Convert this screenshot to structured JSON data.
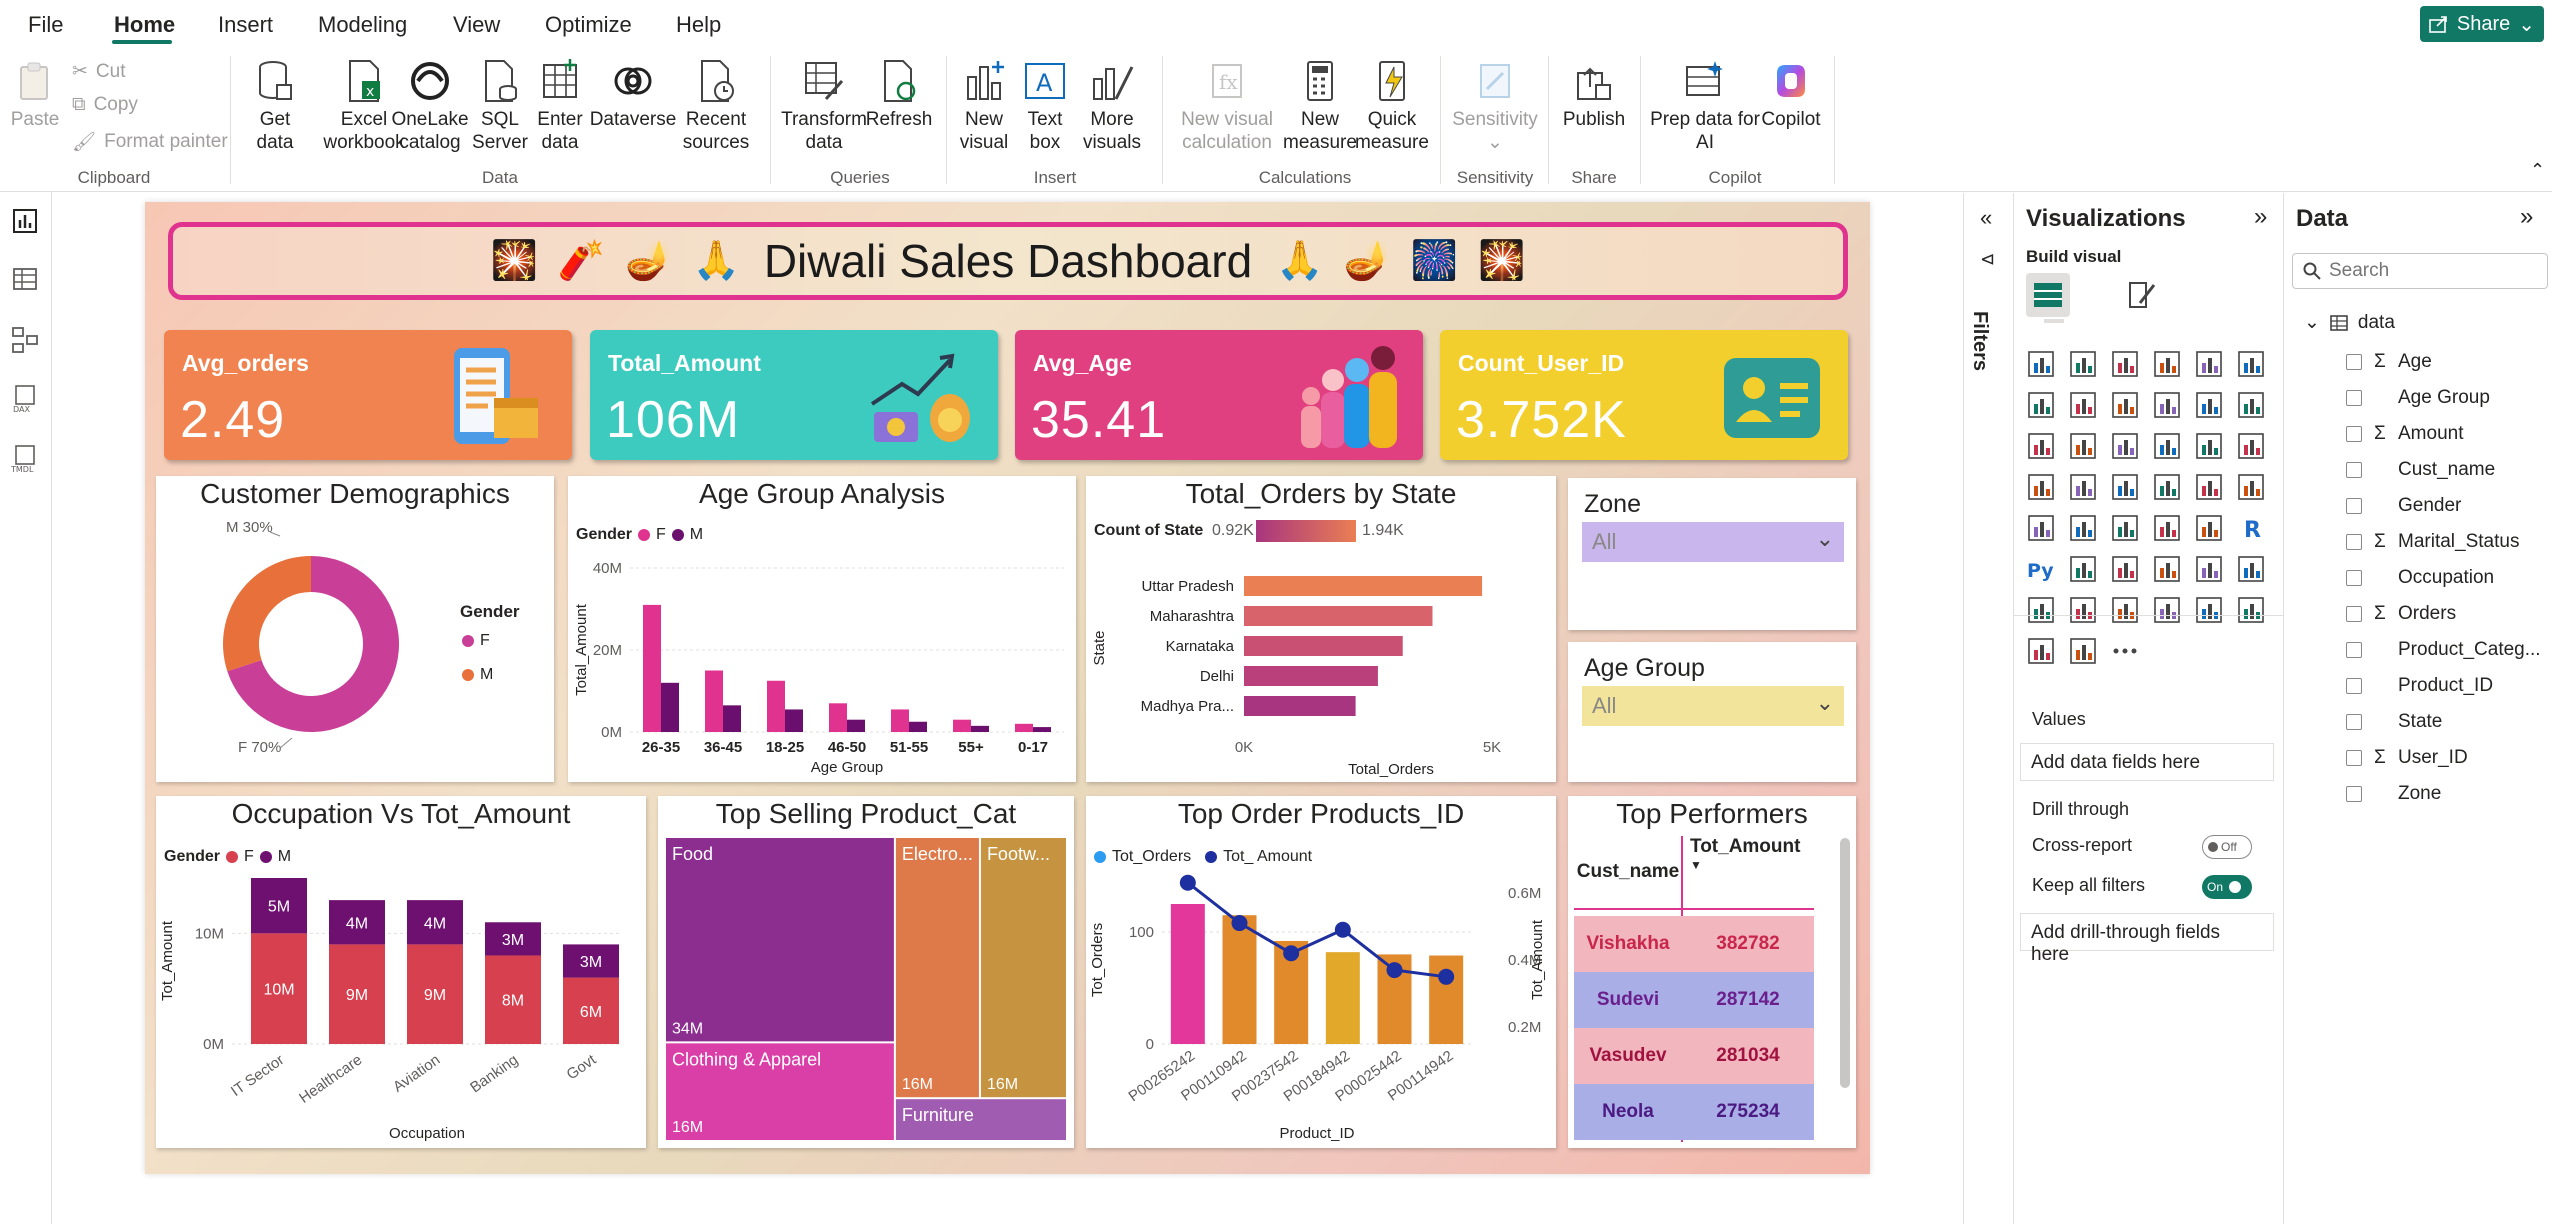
{
  "menu": {
    "items": [
      "File",
      "Home",
      "Insert",
      "Modeling",
      "View",
      "Optimize",
      "Help"
    ],
    "share_label": "Share"
  },
  "ribbon": {
    "clipboard": {
      "paste": "Paste",
      "cut": "Cut",
      "copy": "Copy",
      "format_painter": "Format painter",
      "group": "Clipboard"
    },
    "data": {
      "get_data": [
        "Get",
        "data"
      ],
      "excel": [
        "Excel",
        "workbook"
      ],
      "onelake": [
        "OneLake",
        "catalog"
      ],
      "sql": [
        "SQL",
        "Server"
      ],
      "enter": [
        "Enter",
        "data"
      ],
      "dataverse": [
        "Dataverse"
      ],
      "recent": [
        "Recent",
        "sources"
      ],
      "group": "Data"
    },
    "queries": {
      "transform": [
        "Transform",
        "data"
      ],
      "refresh": [
        "Refresh"
      ],
      "group": "Queries"
    },
    "insert": {
      "new_visual": [
        "New",
        "visual"
      ],
      "text_box": [
        "Text",
        "box"
      ],
      "more_visuals": [
        "More",
        "visuals"
      ],
      "group": "Insert"
    },
    "calculations": {
      "new_visual_calc": [
        "New visual",
        "calculation"
      ],
      "new_measure": [
        "New",
        "measure"
      ],
      "quick_measure": [
        "Quick",
        "measure"
      ],
      "group": "Calculations"
    },
    "sensitivity": {
      "label": [
        "Sensitivity"
      ],
      "group": "Sensitivity"
    },
    "share": {
      "publish": [
        "Publish"
      ],
      "group": "Share"
    },
    "copilot": {
      "prep": [
        "Prep data for",
        "AI"
      ],
      "copilot": [
        "Copilot"
      ],
      "group": "Copilot"
    }
  },
  "report": {
    "title": "Diwali Sales Dashboard",
    "kpis": [
      {
        "label": "Avg_orders",
        "value": "2.49",
        "color": "#f0834f"
      },
      {
        "label": "Total_Amount",
        "value": "106M",
        "color": "#3dcbbf"
      },
      {
        "label": "Avg_Age",
        "value": "35.41",
        "color": "#e0407f"
      },
      {
        "label": "Count_User_ID",
        "value": "3.752K",
        "color": "#f2cf2c"
      }
    ],
    "slicers": [
      {
        "title": "Zone",
        "value": "All",
        "color": "#c8b6ec"
      },
      {
        "title": "Age Group",
        "value": "All",
        "color": "#f2e49a"
      }
    ]
  },
  "chart_data": [
    {
      "id": "customer-demographics",
      "type": "pie",
      "title": "Customer Demographics",
      "legend_title": "Gender",
      "categories": [
        "F",
        "M"
      ],
      "values": [
        70,
        30
      ],
      "labels": [
        "F 70%",
        "M 30%"
      ],
      "colors": [
        "#c93f97",
        "#e8703b"
      ],
      "legend": "right"
    },
    {
      "id": "age-group-analysis",
      "type": "bar",
      "title": "Age Group Analysis",
      "legend_title": "Gender",
      "categories": [
        "26-35",
        "36-45",
        "18-25",
        "46-50",
        "51-55",
        "55+",
        "0-17"
      ],
      "series": [
        {
          "name": "F",
          "values": [
            31,
            15,
            12.5,
            7,
            5.5,
            3,
            2
          ],
          "color": "#e0338f"
        },
        {
          "name": "M",
          "values": [
            12,
            6.5,
            5.5,
            3,
            2.5,
            1.5,
            1.2
          ],
          "color": "#6a0f6e"
        }
      ],
      "xlabel": "Age Group",
      "ylabel": "Total_Amount",
      "yticks": [
        "0M",
        "20M",
        "40M"
      ],
      "ylim": [
        0,
        40
      ]
    },
    {
      "id": "total-orders-by-state",
      "type": "bar",
      "orientation": "horizontal",
      "title": "Total_Orders by State",
      "color_legend_title": "Count of State",
      "color_min_label": "0.92K",
      "color_max_label": "1.94K",
      "categories": [
        "Uttar Pradesh",
        "Maharashtra",
        "Karnataka",
        "Delhi",
        "Madhya Pra..."
      ],
      "values": [
        4800,
        3800,
        3200,
        2700,
        2250
      ],
      "colors": [
        "#ea7f53",
        "#d9636a",
        "#c95072",
        "#b9407b",
        "#a8357f"
      ],
      "xlabel": "Total_Orders",
      "ylabel": "State",
      "xticks": [
        "0K",
        "5K"
      ],
      "xlim": [
        0,
        5000
      ]
    },
    {
      "id": "occupation-vs-amount",
      "type": "bar",
      "stacked": true,
      "title": "Occupation Vs Tot_Amount",
      "legend_title": "Gender",
      "categories": [
        "IT Sector",
        "Healthcare",
        "Aviation",
        "Banking",
        "Govt"
      ],
      "series": [
        {
          "name": "F",
          "values": [
            10,
            9,
            9,
            8,
            6
          ],
          "labels": [
            "10M",
            "9M",
            "9M",
            "8M",
            "6M"
          ],
          "color": "#d6404f"
        },
        {
          "name": "M",
          "values": [
            5,
            4,
            4,
            3,
            3
          ],
          "labels": [
            "5M",
            "4M",
            "4M",
            "3M",
            "3M"
          ],
          "color": "#6e1070"
        }
      ],
      "xlabel": "Occupation",
      "ylabel": "Tot_Amount",
      "yticks": [
        "0M",
        "10M"
      ],
      "ylim": [
        0,
        15
      ]
    },
    {
      "id": "top-selling-product-cat",
      "type": "treemap",
      "title": "Top Selling Product_Cat",
      "items": [
        {
          "name": "Food",
          "value": 34,
          "label": "34M",
          "color": "#8b2e8f"
        },
        {
          "name": "Clothing & Apparel",
          "value": 16,
          "label": "16M",
          "color": "#d93fa7"
        },
        {
          "name": "Electro...",
          "value": 16,
          "label": "16M",
          "color": "#de7a4a"
        },
        {
          "name": "Footw...",
          "value": 16,
          "label": "16M",
          "color": "#c69440"
        },
        {
          "name": "Furniture",
          "value": 5,
          "label": "",
          "color": "#a05cb0"
        }
      ]
    },
    {
      "id": "top-order-products",
      "type": "bar",
      "combo": "line",
      "title": "Top Order Products_ID",
      "categories": [
        "P00265242",
        "P00110942",
        "P00237542",
        "P00184942",
        "P00025442",
        "P00114942"
      ],
      "series": [
        {
          "name": "Tot_Orders",
          "values": [
            125,
            115,
            92,
            82,
            80,
            79
          ],
          "color": "#2b9cf0"
        },
        {
          "name": "Tot_ Amount",
          "values": [
            0.63,
            0.51,
            0.42,
            0.49,
            0.37,
            0.35
          ],
          "color": "#1e2fa0"
        }
      ],
      "bar_colors": [
        "#e3379c",
        "#e08a2c",
        "#e08a2c",
        "#e1a82a",
        "#e08a2c",
        "#e08a2c"
      ],
      "xlabel": "Product_ID",
      "ylabel": "Tot_Orders",
      "y2label": "Tot_Amount",
      "yticks": [
        "0",
        "100"
      ],
      "y2ticks": [
        "0.2M",
        "0.4M",
        "0.6M"
      ],
      "ylim": [
        0,
        150
      ],
      "y2lim": [
        0.15,
        0.65
      ]
    },
    {
      "id": "top-performers",
      "type": "table",
      "title": "Top Performers",
      "columns": [
        "Cust_name",
        "Tot_Amount"
      ],
      "rows": [
        [
          "Vishakha",
          "382782"
        ],
        [
          "Sudevi",
          "287142"
        ],
        [
          "Vasudev",
          "281034"
        ],
        [
          "Neola",
          "275234"
        ]
      ],
      "row_colors": [
        "#f2b6bf",
        "#a9aee6",
        "#f2b6bf",
        "#a9aee6"
      ],
      "text_colors": [
        "#c8264a",
        "#6a1f8c",
        "#a0123f",
        "#4b1a82"
      ]
    }
  ],
  "filters": {
    "label": "Filters"
  },
  "visualizations": {
    "title": "Visualizations",
    "build_visual": "Build visual",
    "values": "Values",
    "add_data_fields": "Add data fields here",
    "drill_through": "Drill through",
    "cross_report": "Cross-report",
    "cross_report_state": "Off",
    "keep_all_filters": "Keep all filters",
    "keep_all_filters_state": "On",
    "add_drill_fields": "Add drill-through fields here"
  },
  "data_pane": {
    "title": "Data",
    "search_placeholder": "Search",
    "table_name": "data",
    "fields": [
      {
        "name": "Age",
        "sigma": true
      },
      {
        "name": "Age Group",
        "sigma": false
      },
      {
        "name": "Amount",
        "sigma": true
      },
      {
        "name": "Cust_name",
        "sigma": false
      },
      {
        "name": "Gender",
        "sigma": false
      },
      {
        "name": "Marital_Status",
        "sigma": true
      },
      {
        "name": "Occupation",
        "sigma": false
      },
      {
        "name": "Orders",
        "sigma": true
      },
      {
        "name": "Product_Categ...",
        "sigma": false
      },
      {
        "name": "Product_ID",
        "sigma": false
      },
      {
        "name": "State",
        "sigma": false
      },
      {
        "name": "User_ID",
        "sigma": true
      },
      {
        "name": "Zone",
        "sigma": false
      }
    ]
  }
}
